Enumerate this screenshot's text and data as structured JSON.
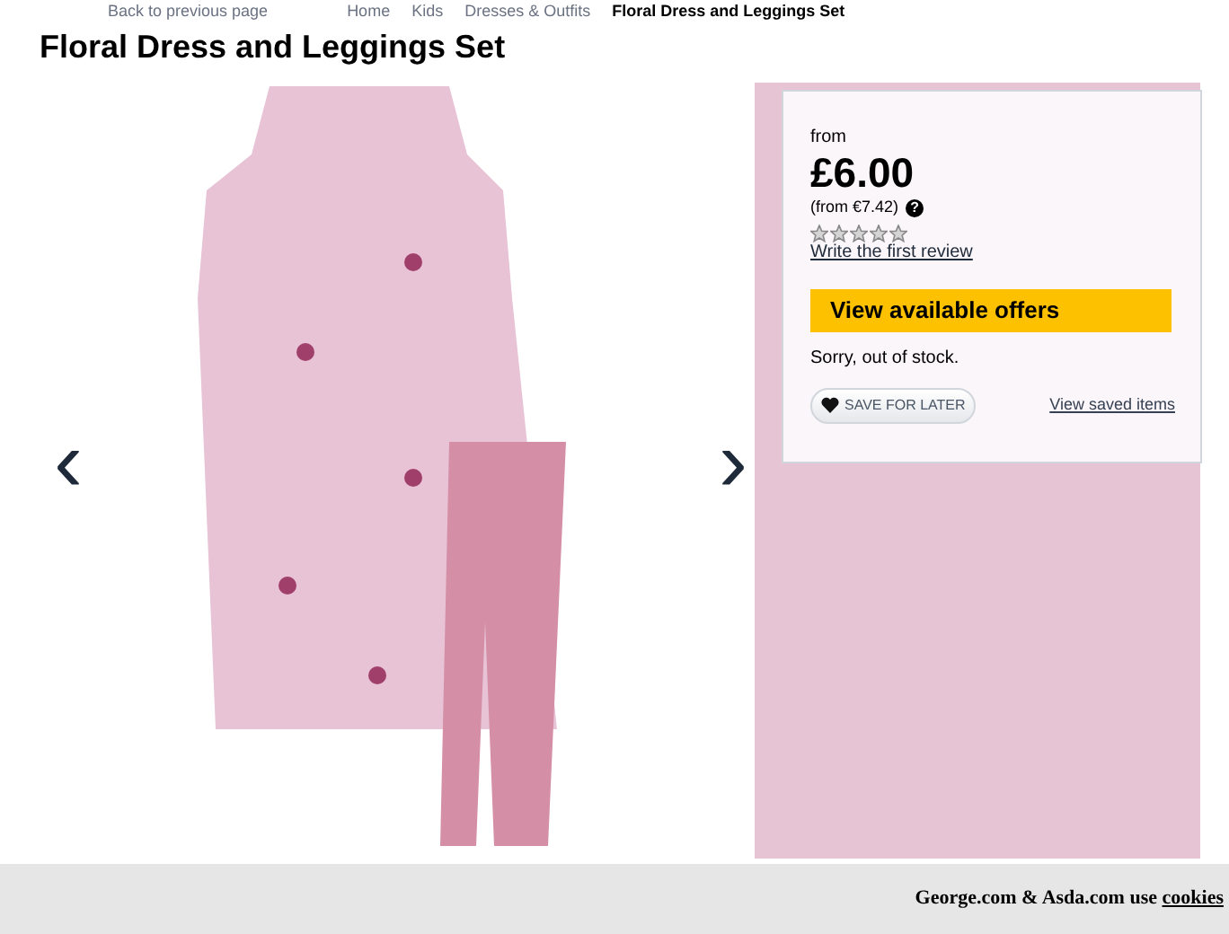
{
  "breadcrumb": {
    "back": "Back to previous page",
    "links": [
      "Home",
      "Kids",
      "Dresses & Outfits"
    ],
    "current": "Floral Dress and Leggings Set"
  },
  "title": "Floral Dress and Leggings Set",
  "gallery": {
    "prev": "‹",
    "next": "›"
  },
  "buy_box": {
    "from": "from",
    "price": "£6.00",
    "alt_price": "(from €7.42)",
    "help_icon": "?",
    "stars": 0,
    "review_link": "Write the first review",
    "offers_button": "View available offers",
    "stock": "Sorry, out of stock.",
    "save_button": "SAVE FOR LATER",
    "saved_link": "View saved items"
  },
  "cookie_bar": {
    "text": "George.com & Asda.com use",
    "link": "cookies"
  }
}
